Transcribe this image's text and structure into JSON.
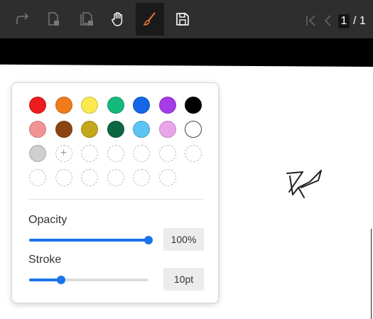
{
  "toolbar": {
    "buttons": [
      {
        "name": "redo-button",
        "icon": "redo-icon"
      },
      {
        "name": "delete-page-button",
        "icon": "page-delete-icon"
      },
      {
        "name": "delete-all-pages-button",
        "icon": "pages-delete-icon"
      },
      {
        "name": "pan-tool-button",
        "icon": "hand-icon"
      },
      {
        "name": "draw-tool-button",
        "icon": "brush-icon",
        "active": true
      },
      {
        "name": "save-button",
        "icon": "save-icon"
      }
    ],
    "active_color": "#e8792b",
    "pagination": {
      "current": "1",
      "separator": "/ 1"
    }
  },
  "color_panel": {
    "preset_colors": [
      "#ee1c1c",
      "#f07b1a",
      "#fbe94f",
      "#14b97c",
      "#1467e6",
      "#a63be8",
      "#000000",
      "#f29494",
      "#8a4512",
      "#c2a81a",
      "#0b6642",
      "#5ac4f5",
      "#eaa4ea",
      "#ffffff",
      "#cfcfcf"
    ],
    "selected_color": "#ffffff",
    "add_symbol": "+",
    "opacity": {
      "label": "Opacity",
      "value": 1.0,
      "text": "100%"
    },
    "stroke": {
      "label": "Stroke",
      "value": 0.27,
      "text": "10pt"
    }
  }
}
